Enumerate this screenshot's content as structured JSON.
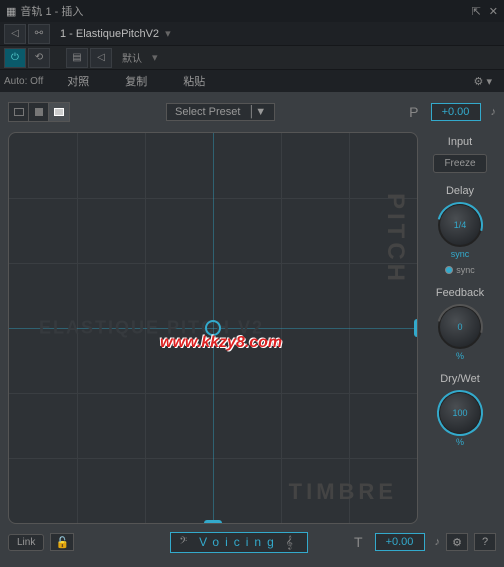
{
  "window": {
    "title": "音轨 1 - 插入",
    "plugin_tab": "1 - ElastiquePitchV2"
  },
  "toolbar": {
    "preset_dropdown": "默认",
    "auto_label": "Auto: Off",
    "tab_compare": "对照",
    "tab_copy": "复制",
    "tab_paste": "粘贴"
  },
  "plugin": {
    "preset_label": "Select Preset",
    "pitch_letter": "P",
    "pitch_value": "+0.00",
    "timbre_letter": "T",
    "timbre_value": "+0.00",
    "pitch_axis": "PITCH",
    "timbre_axis": "TIMBRE",
    "ghost": "ELASTIQUE PITCH V2",
    "link_label": "Link",
    "voicing_label": "Voicing"
  },
  "side": {
    "input_label": "Input",
    "freeze_label": "Freeze",
    "delay_label": "Delay",
    "delay_value": "1/4",
    "delay_unit": "sync",
    "sync_label": "sync",
    "feedback_label": "Feedback",
    "feedback_value": "0",
    "feedback_unit": "%",
    "drywet_label": "Dry/Wet",
    "drywet_value": "100",
    "drywet_unit": "%"
  },
  "watermark": "www.kkzy8.com"
}
